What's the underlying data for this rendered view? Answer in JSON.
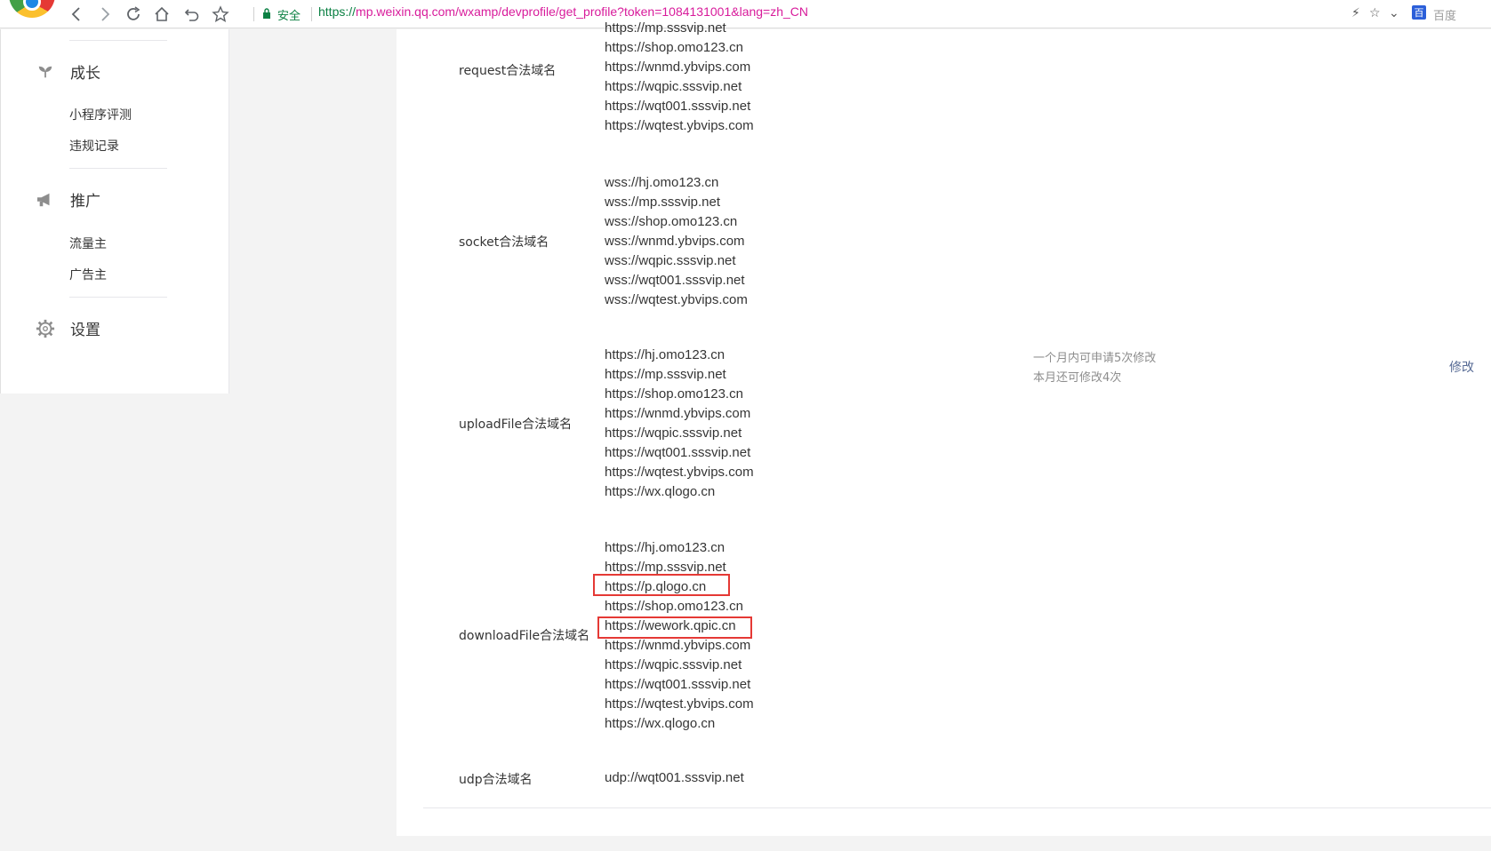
{
  "browser": {
    "secure_label": "安全",
    "url_scheme": "https://",
    "url_rest": "mp.weixin.qq.com/wxamp/devprofile/get_profile?token=1084131001&lang=zh_CN",
    "search_engine_label": "百度",
    "search_engine_glyph": "百"
  },
  "sidebar": {
    "sections": [
      {
        "title": "成长",
        "icon": "sprout-icon",
        "items": [
          "小程序评测",
          "违规记录"
        ]
      },
      {
        "title": "推广",
        "icon": "megaphone-icon",
        "items": [
          "流量主",
          "广告主"
        ]
      },
      {
        "title": "设置",
        "icon": "gear-icon",
        "items": []
      }
    ]
  },
  "main": {
    "rows": [
      {
        "label": "request合法域名",
        "domains": [
          "https://mp.sssvip.net",
          "https://shop.omo123.cn",
          "https://wnmd.ybvips.com",
          "https://wqpic.sssvip.net",
          "https://wqt001.sssvip.net",
          "https://wqtest.ybvips.com"
        ]
      },
      {
        "label": "socket合法域名",
        "domains": [
          "wss://hj.omo123.cn",
          "wss://mp.sssvip.net",
          "wss://shop.omo123.cn",
          "wss://wnmd.ybvips.com",
          "wss://wqpic.sssvip.net",
          "wss://wqt001.sssvip.net",
          "wss://wqtest.ybvips.com"
        ]
      },
      {
        "label": "uploadFile合法域名",
        "domains": [
          "https://hj.omo123.cn",
          "https://mp.sssvip.net",
          "https://shop.omo123.cn",
          "https://wnmd.ybvips.com",
          "https://wqpic.sssvip.net",
          "https://wqt001.sssvip.net",
          "https://wqtest.ybvips.com",
          "https://wx.qlogo.cn"
        ]
      },
      {
        "label": "downloadFile合法域名",
        "domains": [
          "https://hj.omo123.cn",
          "https://mp.sssvip.net",
          "https://p.qlogo.cn",
          "https://shop.omo123.cn",
          "https://wework.qpic.cn",
          "https://wnmd.ybvips.com",
          "https://wqpic.sssvip.net",
          "https://wqt001.sssvip.net",
          "https://wqtest.ybvips.com",
          "https://wx.qlogo.cn"
        ]
      },
      {
        "label": "udp合法域名",
        "domains": [
          "udp://wqt001.sssvip.net"
        ]
      }
    ],
    "limit_note_1": "一个月内可申请5次修改",
    "limit_note_2": "本月还可修改4次",
    "edit_label": "修改",
    "highlight_color": "#e53935"
  }
}
